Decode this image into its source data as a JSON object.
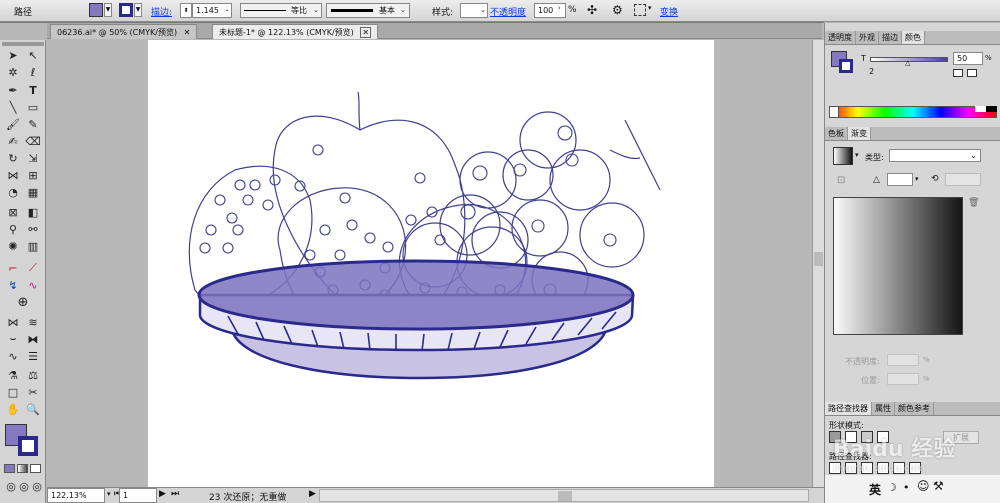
{
  "control_bar": {
    "path_label": "路径",
    "stroke_label": "描边:",
    "stroke_value": "1.145",
    "profile_label": "等比",
    "brush_label": "基本",
    "style_label": "样式:",
    "opacity_label": "不透明度",
    "opacity_value": "100",
    "opacity_unit": "%",
    "transform_label": "变换",
    "fill_color": "#8478c0",
    "stroke_color": "#2a2a8c"
  },
  "doc_tabs": [
    {
      "label": "06236.ai* @ 50% (CMYK/预览)"
    },
    {
      "label": "未标题-1* @ 122.13% (CMYK/预览)"
    }
  ],
  "status_bar": {
    "zoom": "122.13%",
    "page": "1",
    "undo_text": "23 次还原；无重做"
  },
  "color_panel": {
    "tabs": [
      "透明度",
      "外观",
      "描边",
      "颜色"
    ],
    "tint_label": "T",
    "tint_value": "50",
    "tint_unit": "%",
    "number_label": "2",
    "swatch_color": "#8478c0"
  },
  "gradient_panel": {
    "tabs": [
      "色板",
      "渐变"
    ],
    "type_label": "类型:",
    "opacity_label": "不透明度:",
    "location_label": "位置:",
    "percent": "%"
  },
  "bottom_panel": {
    "tabs": [
      "路径查找器",
      "属性",
      "颜色参考"
    ],
    "shape_mode_label": "形状模式:",
    "pathfinder_label": "路径查找器:",
    "expand_label": "扩展"
  },
  "watermark": {
    "text": "Baidu 经验",
    "sub": "jingyan.baidu.com",
    "ime": "英"
  }
}
